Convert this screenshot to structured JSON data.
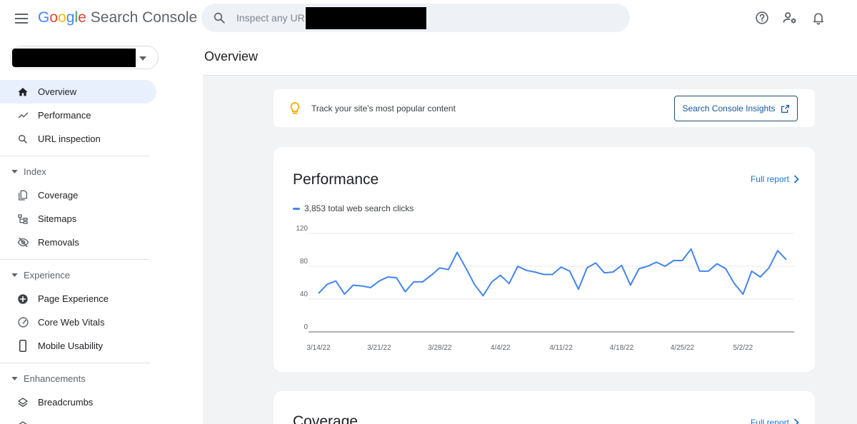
{
  "header": {
    "app_name_letters": [
      "G",
      "o",
      "o",
      "g",
      "l",
      "e"
    ],
    "product_name": "Search Console",
    "search_placeholder": "Inspect any URL"
  },
  "icons": {
    "menu": "menu-icon",
    "search": "search-icon",
    "help": "help-icon",
    "users": "manage-users-icon",
    "notifications": "bell-icon"
  },
  "sidebar": {
    "property_selector": {
      "value_redacted": true
    },
    "items_top": [
      {
        "label": "Overview",
        "icon": "home-icon",
        "active": true
      },
      {
        "label": "Performance",
        "icon": "trending-up-icon"
      },
      {
        "label": "URL inspection",
        "icon": "search-icon"
      }
    ],
    "sections": [
      {
        "label": "Index",
        "items": [
          {
            "label": "Coverage",
            "icon": "file-copy-icon"
          },
          {
            "label": "Sitemaps",
            "icon": "sitemap-icon"
          },
          {
            "label": "Removals",
            "icon": "visibility-off-icon"
          }
        ]
      },
      {
        "label": "Experience",
        "items": [
          {
            "label": "Page Experience",
            "icon": "add-circle-icon"
          },
          {
            "label": "Core Web Vitals",
            "icon": "speed-icon"
          },
          {
            "label": "Mobile Usability",
            "icon": "phone-icon"
          }
        ]
      },
      {
        "label": "Enhancements",
        "items": [
          {
            "label": "Breadcrumbs",
            "icon": "layers-icon"
          }
        ]
      }
    ]
  },
  "main": {
    "page_title": "Overview",
    "tip": {
      "text": "Track your site's most popular content",
      "button_label": "Search Console Insights"
    },
    "performance": {
      "title": "Performance",
      "full_report": "Full report",
      "legend": "3,853 total web search clicks"
    },
    "coverage": {
      "title": "Coverage",
      "full_report": "Full report"
    }
  },
  "colors": {
    "brand_blue": "#4285f4",
    "link_blue": "#1a73e8",
    "active_nav_bg": "#e8f0fe",
    "tip_bulb": "#f9ab00"
  },
  "chart_data": {
    "type": "line",
    "title": "",
    "xlabel": "",
    "ylabel": "",
    "ylim": [
      0,
      120
    ],
    "yticks": [
      0,
      40,
      80,
      120
    ],
    "xtick_labels": [
      "3/14/22",
      "3/21/22",
      "3/28/22",
      "4/4/22",
      "4/11/22",
      "4/18/22",
      "4/25/22",
      "5/2/22"
    ],
    "start_date": "3/14/22",
    "grid": true,
    "series": [
      {
        "name": "3,853 total web search clicks",
        "color": "#4285f4",
        "values": [
          47,
          58,
          62,
          46,
          57,
          56,
          54,
          62,
          67,
          66,
          49,
          61,
          61,
          69,
          78,
          76,
          97,
          78,
          58,
          44,
          61,
          69,
          59,
          80,
          75,
          73,
          70,
          70,
          79,
          74,
          52,
          78,
          84,
          72,
          73,
          81,
          57,
          77,
          80,
          85,
          80,
          87,
          87,
          101,
          74,
          74,
          83,
          77,
          59,
          46,
          74,
          67,
          78,
          99,
          88
        ]
      }
    ]
  }
}
